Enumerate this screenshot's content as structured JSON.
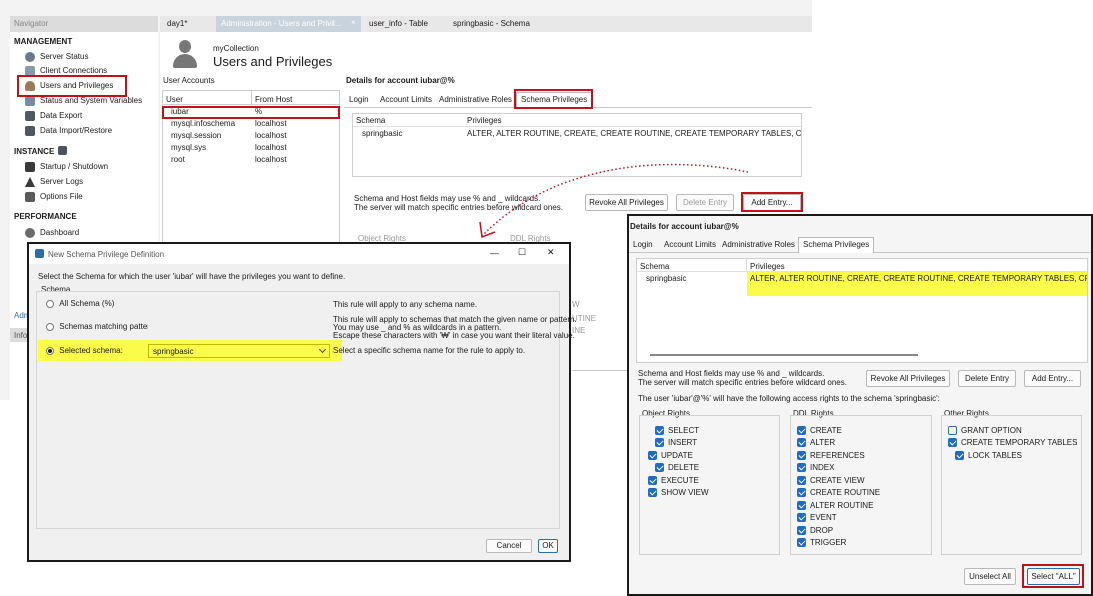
{
  "navigator": {
    "title": "Navigator",
    "management_label": "MANAGEMENT",
    "management_items": [
      "Server Status",
      "Client Connections",
      "Users and Privileges",
      "Status and System Variables",
      "Data Export",
      "Data Import/Restore"
    ],
    "instance_label": "INSTANCE",
    "instance_items": [
      "Startup / Shutdown",
      "Server Logs",
      "Options File"
    ],
    "performance_label": "PERFORMANCE",
    "performance_items": [
      "Dashboard"
    ],
    "adm_fragment": "Adm",
    "info_fragment": "Info"
  },
  "tabs": {
    "t1": "day1*",
    "t2": "Administration - Users and Privil...",
    "t2_close": "×",
    "t3": "user_info - Table",
    "t4": "springbasic - Schema"
  },
  "header": {
    "connection": "myCollection",
    "title": "Users and Privileges"
  },
  "accounts": {
    "label": "User Accounts",
    "col_user": "User",
    "col_host": "From Host",
    "rows": [
      {
        "user": "iubar",
        "host": "%"
      },
      {
        "user": "mysql.infoschema",
        "host": "localhost"
      },
      {
        "user": "mysql.session",
        "host": "localhost"
      },
      {
        "user": "mysql.sys",
        "host": "localhost"
      },
      {
        "user": "root",
        "host": "localhost"
      }
    ]
  },
  "details_bg": {
    "title": "Details for account iubar@%",
    "tabs": [
      "Login",
      "Account Limits",
      "Administrative Roles",
      "Schema Privileges"
    ],
    "col_schema": "Schema",
    "col_priv": "Privileges",
    "row_schema": "springbasic",
    "row_priv": "ALTER, ALTER ROUTINE, CREATE, CREATE ROUTINE, CREATE TEMPORARY TABLES, CREA",
    "hint1": "Schema and Host fields may use % and _ wildcards.",
    "hint2": "The server will match specific entries before wildcard ones.",
    "btn_revoke": "Revoke All Privileges",
    "btn_delete": "Delete Entry",
    "btn_add": "Add Entry...",
    "object_rights": "Object Rights",
    "ddl_rights": "DDL Rights",
    "frag1": "W",
    "frag2": "UTINE",
    "frag3": "INE"
  },
  "dialog": {
    "title": "New Schema Privilege Definition",
    "minimize": "—",
    "maximize": "☐",
    "close": "✕",
    "intro": "Select the Schema for which the user 'iubar' will have the privileges you want to define.",
    "schema_group": "Schema",
    "opt_all": "All Schema (%)",
    "opt_all_desc": "This rule will apply to any schema name.",
    "opt_pattern": "Schemas matching pattern:",
    "opt_pattern_desc1": "This rule will apply to schemas that match the given name or pattern.",
    "opt_pattern_desc2": "You may use _ and % as wildcards in a pattern.",
    "opt_pattern_desc3": "Escape these characters with '₩' in case you want their literal value.",
    "opt_selected": "Selected schema:",
    "selected_value": "springbasic",
    "opt_selected_desc": "Select a specific schema name for the rule to apply to.",
    "cancel": "Cancel",
    "ok": "OK"
  },
  "details": {
    "title": "Details for account iubar@%",
    "tabs": [
      "Login",
      "Account Limits",
      "Administrative Roles",
      "Schema Privileges"
    ],
    "col_schema": "Schema",
    "col_priv": "Privileges",
    "row_schema": "springbasic",
    "row_priv": "ALTER, ALTER ROUTINE, CREATE, CREATE ROUTINE, CREATE TEMPORARY TABLES, CRE/",
    "hint1": "Schema and Host fields may use % and _ wildcards.",
    "hint2": "The server will match specific entries before wildcard ones.",
    "btn_revoke": "Revoke All Privileges",
    "btn_delete": "Delete Entry",
    "btn_add": "Add Entry...",
    "access_text": "The user 'iubar'@'%' will have the following access rights to the schema 'springbasic':",
    "object_rights": "Object Rights",
    "ddl_rights": "DDL Rights",
    "other_rights": "Other Rights",
    "object_items": [
      {
        "label": "SELECT",
        "checked": true
      },
      {
        "label": "INSERT",
        "checked": true
      },
      {
        "label": "UPDATE",
        "checked": true
      },
      {
        "label": "DELETE",
        "checked": true
      },
      {
        "label": "EXECUTE",
        "checked": true
      },
      {
        "label": "SHOW VIEW",
        "checked": true
      }
    ],
    "ddl_items": [
      {
        "label": "CREATE",
        "checked": true
      },
      {
        "label": "ALTER",
        "checked": true
      },
      {
        "label": "REFERENCES",
        "checked": true
      },
      {
        "label": "INDEX",
        "checked": true
      },
      {
        "label": "CREATE VIEW",
        "checked": true
      },
      {
        "label": "CREATE ROUTINE",
        "checked": true
      },
      {
        "label": "ALTER ROUTINE",
        "checked": true
      },
      {
        "label": "EVENT",
        "checked": true
      },
      {
        "label": "DROP",
        "checked": true
      },
      {
        "label": "TRIGGER",
        "checked": true
      }
    ],
    "other_items": [
      {
        "label": "GRANT OPTION",
        "checked": false
      },
      {
        "label": "CREATE TEMPORARY TABLES",
        "checked": true
      },
      {
        "label": "LOCK TABLES",
        "checked": true
      }
    ],
    "btn_unselect": "Unselect All",
    "btn_select_all": "Select \"ALL\""
  },
  "colors": {
    "highlight": "#fbfb4a",
    "annotation_red": "#c0121a",
    "checkbox_blue": "#1f6cc7"
  }
}
